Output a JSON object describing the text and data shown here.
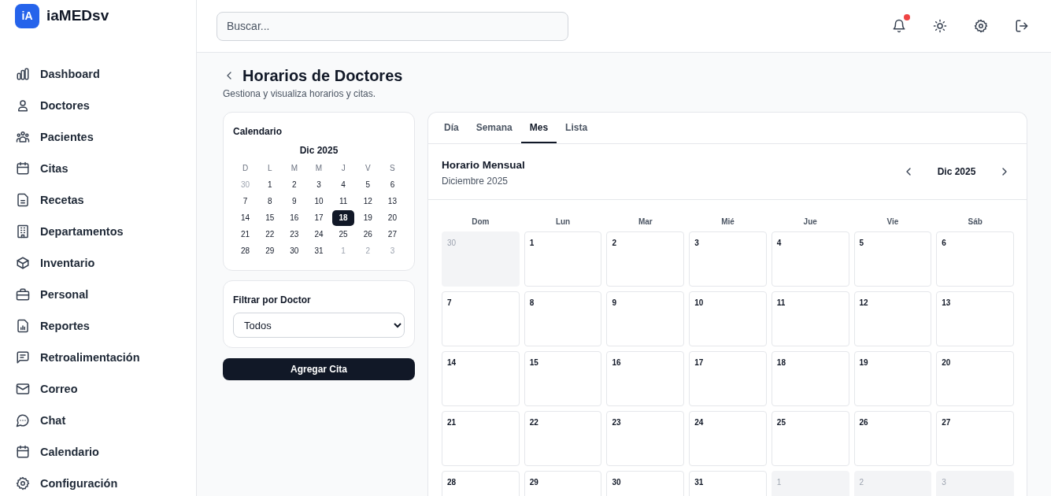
{
  "brand": {
    "badge": "iA",
    "name": "iaMEDsv"
  },
  "sidebar": {
    "items": [
      {
        "label": "Dashboard"
      },
      {
        "label": "Doctores"
      },
      {
        "label": "Pacientes"
      },
      {
        "label": "Citas"
      },
      {
        "label": "Recetas"
      },
      {
        "label": "Departamentos"
      },
      {
        "label": "Inventario"
      },
      {
        "label": "Personal"
      },
      {
        "label": "Reportes"
      },
      {
        "label": "Retroalimentación"
      },
      {
        "label": "Correo"
      },
      {
        "label": "Chat"
      },
      {
        "label": "Calendario"
      },
      {
        "label": "Configuración"
      }
    ]
  },
  "topbar": {
    "search": {
      "placeholder": "Buscar..."
    },
    "notifications": {
      "unread": true
    }
  },
  "page": {
    "title": "Horarios de Doctores",
    "subtitle": "Gestiona y visualiza horarios y citas."
  },
  "mini_calendar": {
    "title": "Calendario",
    "month": "Dic 2025",
    "weekdays": [
      "D",
      "L",
      "M",
      "M",
      "J",
      "V",
      "S"
    ],
    "days": [
      {
        "label": "30",
        "muted": true,
        "selected": false
      },
      {
        "label": "1",
        "muted": false,
        "selected": false
      },
      {
        "label": "2",
        "muted": false,
        "selected": false
      },
      {
        "label": "3",
        "muted": false,
        "selected": false
      },
      {
        "label": "4",
        "muted": false,
        "selected": false
      },
      {
        "label": "5",
        "muted": false,
        "selected": false
      },
      {
        "label": "6",
        "muted": false,
        "selected": false
      },
      {
        "label": "7",
        "muted": false,
        "selected": false
      },
      {
        "label": "8",
        "muted": false,
        "selected": false
      },
      {
        "label": "9",
        "muted": false,
        "selected": false
      },
      {
        "label": "10",
        "muted": false,
        "selected": false
      },
      {
        "label": "11",
        "muted": false,
        "selected": false
      },
      {
        "label": "12",
        "muted": false,
        "selected": false
      },
      {
        "label": "13",
        "muted": false,
        "selected": false
      },
      {
        "label": "14",
        "muted": false,
        "selected": false
      },
      {
        "label": "15",
        "muted": false,
        "selected": false
      },
      {
        "label": "16",
        "muted": false,
        "selected": false
      },
      {
        "label": "17",
        "muted": false,
        "selected": false
      },
      {
        "label": "18",
        "muted": false,
        "selected": true
      },
      {
        "label": "19",
        "muted": false,
        "selected": false
      },
      {
        "label": "20",
        "muted": false,
        "selected": false
      },
      {
        "label": "21",
        "muted": false,
        "selected": false
      },
      {
        "label": "22",
        "muted": false,
        "selected": false
      },
      {
        "label": "23",
        "muted": false,
        "selected": false
      },
      {
        "label": "24",
        "muted": false,
        "selected": false
      },
      {
        "label": "25",
        "muted": false,
        "selected": false
      },
      {
        "label": "26",
        "muted": false,
        "selected": false
      },
      {
        "label": "27",
        "muted": false,
        "selected": false
      },
      {
        "label": "28",
        "muted": false,
        "selected": false
      },
      {
        "label": "29",
        "muted": false,
        "selected": false
      },
      {
        "label": "30",
        "muted": false,
        "selected": false
      },
      {
        "label": "31",
        "muted": false,
        "selected": false
      },
      {
        "label": "1",
        "muted": true,
        "selected": false
      },
      {
        "label": "2",
        "muted": true,
        "selected": false
      },
      {
        "label": "3",
        "muted": true,
        "selected": false
      }
    ]
  },
  "filter": {
    "label": "Filtrar por Doctor",
    "value": "Todos"
  },
  "add_button": "Agregar Cita",
  "schedule": {
    "tabs": [
      {
        "label": "Día",
        "selected": false
      },
      {
        "label": "Semana",
        "selected": false
      },
      {
        "label": "Mes",
        "selected": true
      },
      {
        "label": "Lista",
        "selected": false
      }
    ],
    "title": "Horario Mensual",
    "subtitle": "Diciembre 2025",
    "month": "Dic 2025",
    "weekdays": [
      "Dom",
      "Lun",
      "Mar",
      "Mié",
      "Jue",
      "Vie",
      "Sáb"
    ],
    "days": [
      {
        "label": "30",
        "muted": true
      },
      {
        "label": "1",
        "muted": false
      },
      {
        "label": "2",
        "muted": false
      },
      {
        "label": "3",
        "muted": false
      },
      {
        "label": "4",
        "muted": false
      },
      {
        "label": "5",
        "muted": false
      },
      {
        "label": "6",
        "muted": false
      },
      {
        "label": "7",
        "muted": false
      },
      {
        "label": "8",
        "muted": false
      },
      {
        "label": "9",
        "muted": false
      },
      {
        "label": "10",
        "muted": false
      },
      {
        "label": "11",
        "muted": false
      },
      {
        "label": "12",
        "muted": false
      },
      {
        "label": "13",
        "muted": false
      },
      {
        "label": "14",
        "muted": false
      },
      {
        "label": "15",
        "muted": false
      },
      {
        "label": "16",
        "muted": false
      },
      {
        "label": "17",
        "muted": false
      },
      {
        "label": "18",
        "muted": false
      },
      {
        "label": "19",
        "muted": false
      },
      {
        "label": "20",
        "muted": false
      },
      {
        "label": "21",
        "muted": false
      },
      {
        "label": "22",
        "muted": false
      },
      {
        "label": "23",
        "muted": false
      },
      {
        "label": "24",
        "muted": false
      },
      {
        "label": "25",
        "muted": false
      },
      {
        "label": "26",
        "muted": false
      },
      {
        "label": "27",
        "muted": false
      },
      {
        "label": "28",
        "muted": false
      },
      {
        "label": "29",
        "muted": false
      },
      {
        "label": "30",
        "muted": false
      },
      {
        "label": "31",
        "muted": false
      },
      {
        "label": "1",
        "muted": true
      },
      {
        "label": "2",
        "muted": true
      },
      {
        "label": "3",
        "muted": true
      }
    ]
  }
}
